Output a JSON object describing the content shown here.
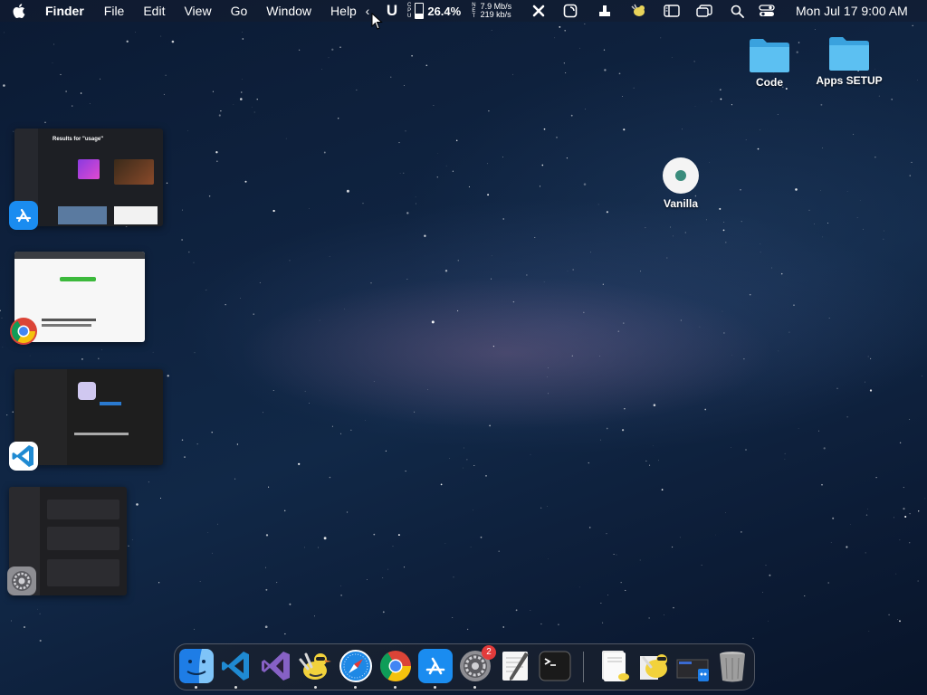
{
  "menubar": {
    "app_name": "Finder",
    "items": [
      "File",
      "Edit",
      "View",
      "Go",
      "Window",
      "Help"
    ],
    "chevron": "‹",
    "cpu_label": [
      "C",
      "P",
      "U"
    ],
    "cpu_percent": "26.4%",
    "net_label": [
      "N",
      "E",
      "T"
    ],
    "net_up": "7.9 Mb/s",
    "net_down": "219 kb/s",
    "clock": "Mon Jul 17  9:00 AM"
  },
  "desktop": {
    "icons": [
      {
        "label": "Code",
        "kind": "folder"
      },
      {
        "label": "Apps SETUP",
        "kind": "folder"
      },
      {
        "label": "Vanilla",
        "kind": "vanilla-app"
      }
    ]
  },
  "stage_manager": {
    "groups": [
      {
        "app": "app-store-icon",
        "thumb_title": "Results for \"usage\""
      },
      {
        "app": "chrome-icon"
      },
      {
        "app": "vscode-icon"
      },
      {
        "app": "system-settings-icon"
      }
    ]
  },
  "dock": {
    "apps": [
      {
        "name": "finder-icon",
        "running": true
      },
      {
        "name": "vscode-icon",
        "running": true
      },
      {
        "name": "visual-studio-icon",
        "running": false
      },
      {
        "name": "cyberduck-icon",
        "running": true
      },
      {
        "name": "safari-icon",
        "running": true
      },
      {
        "name": "chrome-icon",
        "running": true
      },
      {
        "name": "app-store-icon",
        "running": true
      },
      {
        "name": "system-settings-icon",
        "running": true,
        "badge": "2"
      },
      {
        "name": "textedit-icon",
        "running": false
      },
      {
        "name": "terminal-icon",
        "running": false
      }
    ],
    "others": [
      "document-stack-icon",
      "beekeeper-icon",
      "screenshot-stack-icon",
      "trash-icon"
    ]
  },
  "colors": {
    "folder": "#4ab3ec",
    "vscode": "#1f8ad2",
    "badge": "#e23b3b"
  }
}
